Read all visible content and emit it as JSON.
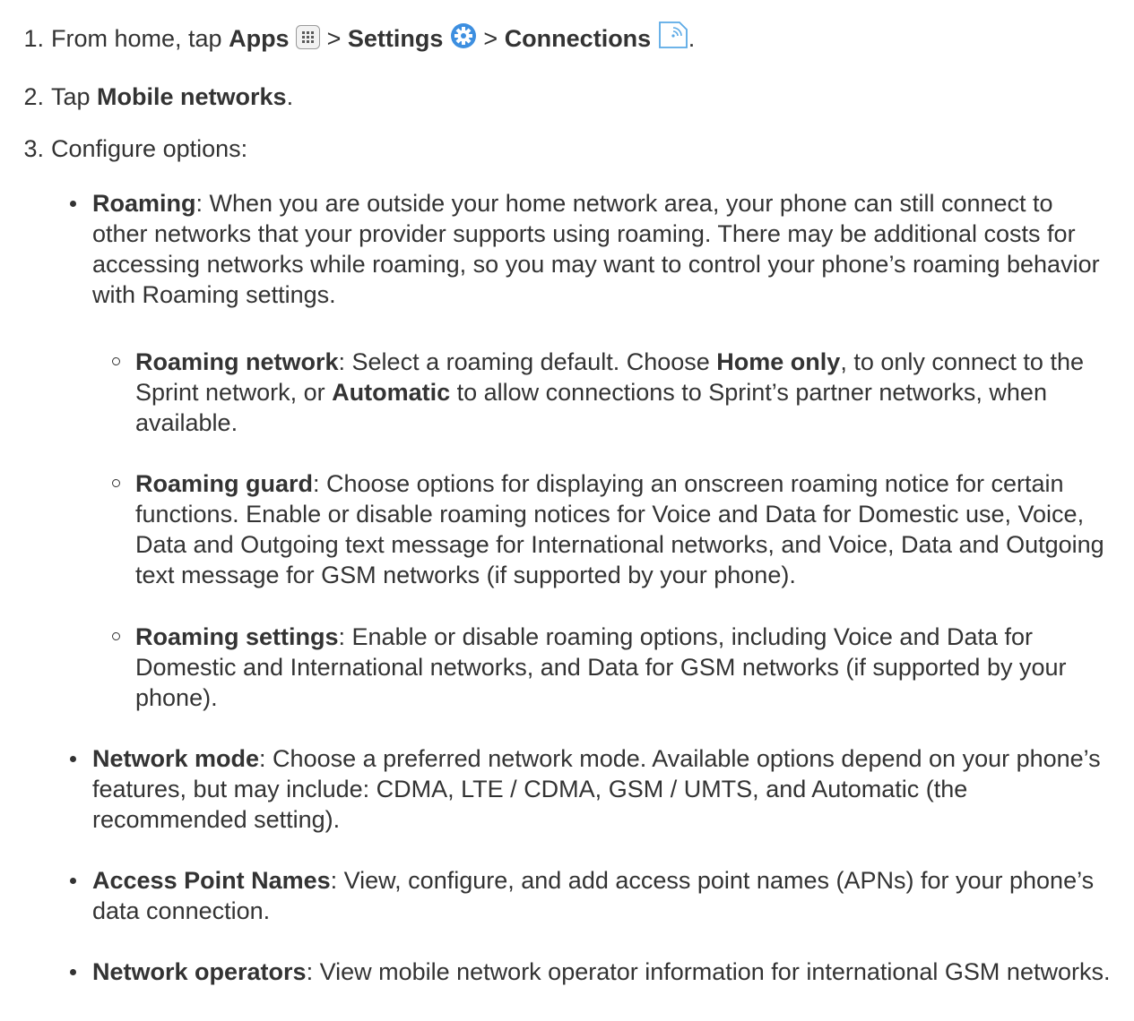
{
  "steps": [
    {
      "num": "1.",
      "pre": "From home, tap ",
      "apps": "Apps",
      "sep1": " > ",
      "settings": "Settings",
      "sep2": " > ",
      "connections": "Connections",
      "end": "."
    },
    {
      "num": "2.",
      "pre": "Tap ",
      "bold": "Mobile networks",
      "end": "."
    },
    {
      "num": "3.",
      "text": "Configure options:"
    }
  ],
  "options": {
    "roaming": {
      "term": "Roaming",
      "desc": ": When you are outside your home network area, your phone can still connect to other networks that your provider supports using roaming. There may be additional costs for accessing networks while roaming, so you may want to control your phone’s roaming behavior with Roaming settings."
    },
    "roaming_network": {
      "term": "Roaming network",
      "desc1": ": Select a roaming default. Choose ",
      "home_only": "Home only",
      "desc2": ", to only connect to the Sprint network, or ",
      "automatic": "Automatic",
      "desc3": " to allow connections to Sprint’s partner networks, when available."
    },
    "roaming_guard": {
      "term": "Roaming guard",
      "desc": ": Choose options for displaying an onscreen roaming notice for certain functions. Enable or disable roaming notices for Voice and Data for Domestic use, Voice, Data and Outgoing text message for International networks, and Voice, Data and Outgoing text message for GSM networks (if supported by your phone)."
    },
    "roaming_settings": {
      "term": "Roaming settings",
      "desc": ": Enable or disable roaming options, including Voice and Data for Domestic and International networks, and Data for GSM networks (if supported by your phone)."
    },
    "network_mode": {
      "term": "Network mode",
      "desc": ": Choose a preferred network mode. Available options depend on your phone’s features, but may include: CDMA, LTE / CDMA, GSM / UMTS, and Automatic (the recommended setting)."
    },
    "apn": {
      "term": "Access Point Names",
      "desc": ": View, configure, and add access point names (APNs) for your phone’s data connection."
    },
    "network_operators": {
      "term": "Network operators",
      "desc": ": View mobile network operator information for international GSM networks."
    }
  },
  "colors": {
    "text": "#333333",
    "settings_icon": "#3d8fe0",
    "connections_icon": "#5aa9e6"
  },
  "icons": [
    "apps-icon",
    "settings-gear-icon",
    "connections-icon"
  ]
}
